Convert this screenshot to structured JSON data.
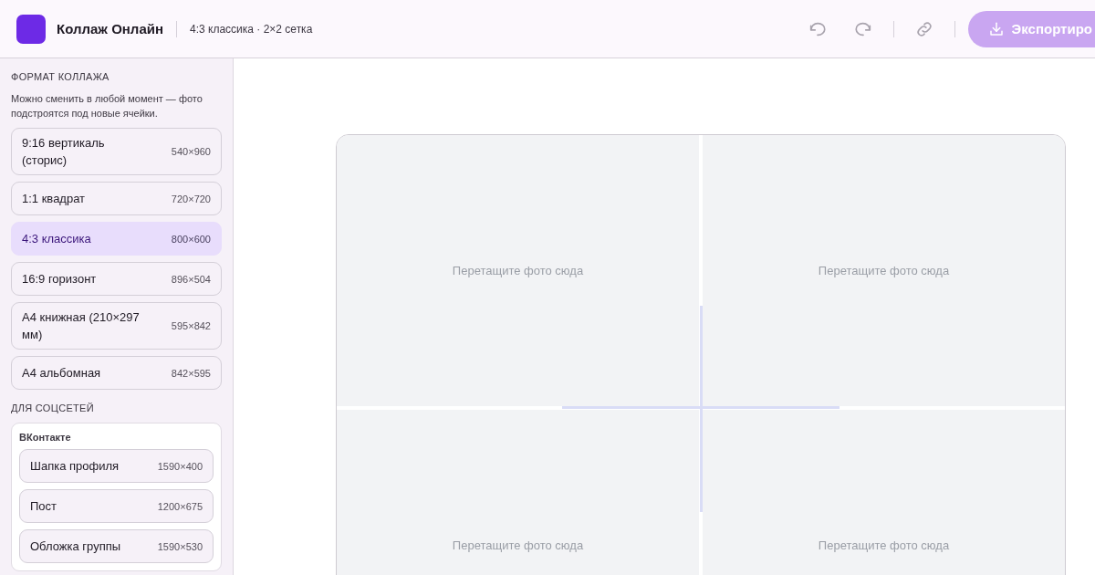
{
  "header": {
    "app_title": "Коллаж Онлайн",
    "subtitle": "4:3 классика · 2×2 сетка",
    "export_label": "Экспортиро"
  },
  "sidebar": {
    "section_title": "ФОРМАТ КОЛЛАЖА",
    "hint": "Можно сменить в любой момент — фото подстроятся под новые ячейки.",
    "formats": [
      {
        "label": "9:16 вертикаль (сторис)",
        "size": "540×960",
        "selected": false
      },
      {
        "label": "1:1 квадрат",
        "size": "720×720",
        "selected": false
      },
      {
        "label": "4:3 классика",
        "size": "800×600",
        "selected": true
      },
      {
        "label": "16:9 горизонт",
        "size": "896×504",
        "selected": false
      },
      {
        "label": "A4 книжная (210×297 мм)",
        "size": "595×842",
        "selected": false
      },
      {
        "label": "A4 альбомная",
        "size": "842×595",
        "selected": false
      }
    ],
    "social_title": "ДЛЯ СОЦСЕТЕЙ",
    "groups": [
      {
        "name": "ВКонтакте",
        "items": [
          {
            "label": "Шапка профиля",
            "size": "1590×400",
            "selected": false
          },
          {
            "label": "Пост",
            "size": "1200×675",
            "selected": false
          },
          {
            "label": "Обложка группы",
            "size": "1590×530",
            "selected": false
          }
        ]
      }
    ]
  },
  "canvas": {
    "cells": [
      {
        "placeholder": "Перетащите фото сюда"
      },
      {
        "placeholder": "Перетащите фото сюда"
      },
      {
        "placeholder": "Перетащите фото сюда"
      },
      {
        "placeholder": "Перетащите фото сюда"
      }
    ]
  }
}
